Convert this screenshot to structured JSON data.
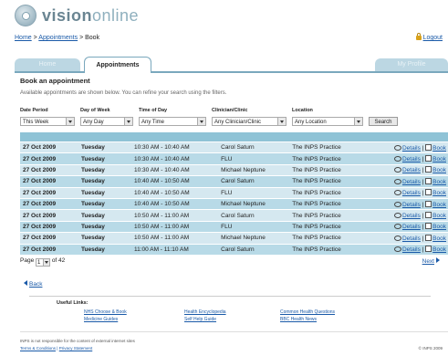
{
  "brand": {
    "bold": "vision",
    "light": "online"
  },
  "breadcrumb": {
    "home": "Home",
    "sep1": ">",
    "appointments": "Appointments",
    "sep2": ">",
    "current": "Book"
  },
  "logout": "Logout",
  "tabs": {
    "home": "Home",
    "appointments": "Appointments",
    "profile": "My Profile"
  },
  "page": {
    "heading": "Book an appointment",
    "intro": "Available appointments are shown below. You can refine your search using the filters."
  },
  "filters": {
    "date_label": "Date Period",
    "date_value": "This Week",
    "dow_label": "Day of Week",
    "dow_value": "Any Day",
    "time_label": "Time of Day",
    "time_value": "Any Time",
    "clinician_label": "Clinician/Clinic",
    "clinician_value": "Any Clinician/Clinic",
    "location_label": "Location",
    "location_value": "Any Location",
    "search_label": "Search"
  },
  "table": {
    "rows": [
      {
        "date": "27 Oct 2009",
        "day": "Tuesday",
        "time": "10:30 AM - 10:40 AM",
        "clinician": "Carol Saturn",
        "location": "The INPS Practice"
      },
      {
        "date": "27 Oct 2009",
        "day": "Tuesday",
        "time": "10:30 AM - 10:40 AM",
        "clinician": "FLU",
        "location": "The INPS Practice"
      },
      {
        "date": "27 Oct 2009",
        "day": "Tuesday",
        "time": "10:30 AM - 10:40 AM",
        "clinician": "Michael Neptune",
        "location": "The INPS Practice"
      },
      {
        "date": "27 Oct 2009",
        "day": "Tuesday",
        "time": "10:40 AM - 10:50 AM",
        "clinician": "Carol Saturn",
        "location": "The INPS Practice"
      },
      {
        "date": "27 Oct 2009",
        "day": "Tuesday",
        "time": "10:40 AM - 10:50 AM",
        "clinician": "FLU",
        "location": "The INPS Practice"
      },
      {
        "date": "27 Oct 2009",
        "day": "Tuesday",
        "time": "10:40 AM - 10:50 AM",
        "clinician": "Michael Neptune",
        "location": "The INPS Practice"
      },
      {
        "date": "27 Oct 2009",
        "day": "Tuesday",
        "time": "10:50 AM - 11:00 AM",
        "clinician": "Carol Saturn",
        "location": "The INPS Practice"
      },
      {
        "date": "27 Oct 2009",
        "day": "Tuesday",
        "time": "10:50 AM - 11:00 AM",
        "clinician": "FLU",
        "location": "The INPS Practice"
      },
      {
        "date": "27 Oct 2009",
        "day": "Tuesday",
        "time": "10:50 AM - 11:00 AM",
        "clinician": "Michael Neptune",
        "location": "The INPS Practice"
      },
      {
        "date": "27 Oct 2009",
        "day": "Tuesday",
        "time": "11:00 AM - 11:10 AM",
        "clinician": "Carol Saturn",
        "location": "The INPS Practice"
      }
    ],
    "details_label": "Details",
    "sep": "|",
    "book_label": "Book"
  },
  "pager": {
    "page_word": "Page",
    "current": "1",
    "of_text": "of 42",
    "next": "Next"
  },
  "back": "Back",
  "useful_links": {
    "title": "Useful Links:",
    "nhs": "NHS Choose & Book",
    "medicine": "Medicine Guides",
    "health_enc": "Health Encyclopedia",
    "self_help": "Self Help Guide",
    "common_q": "Common Health Questions",
    "bbc": "BBC Health News"
  },
  "footer": {
    "note": "INPS is not responsible for the content of external internet sites",
    "terms": "Terms & Conditions",
    "sep": "|",
    "privacy": "Privacy Statement",
    "copyright": "© INPS 2009"
  }
}
